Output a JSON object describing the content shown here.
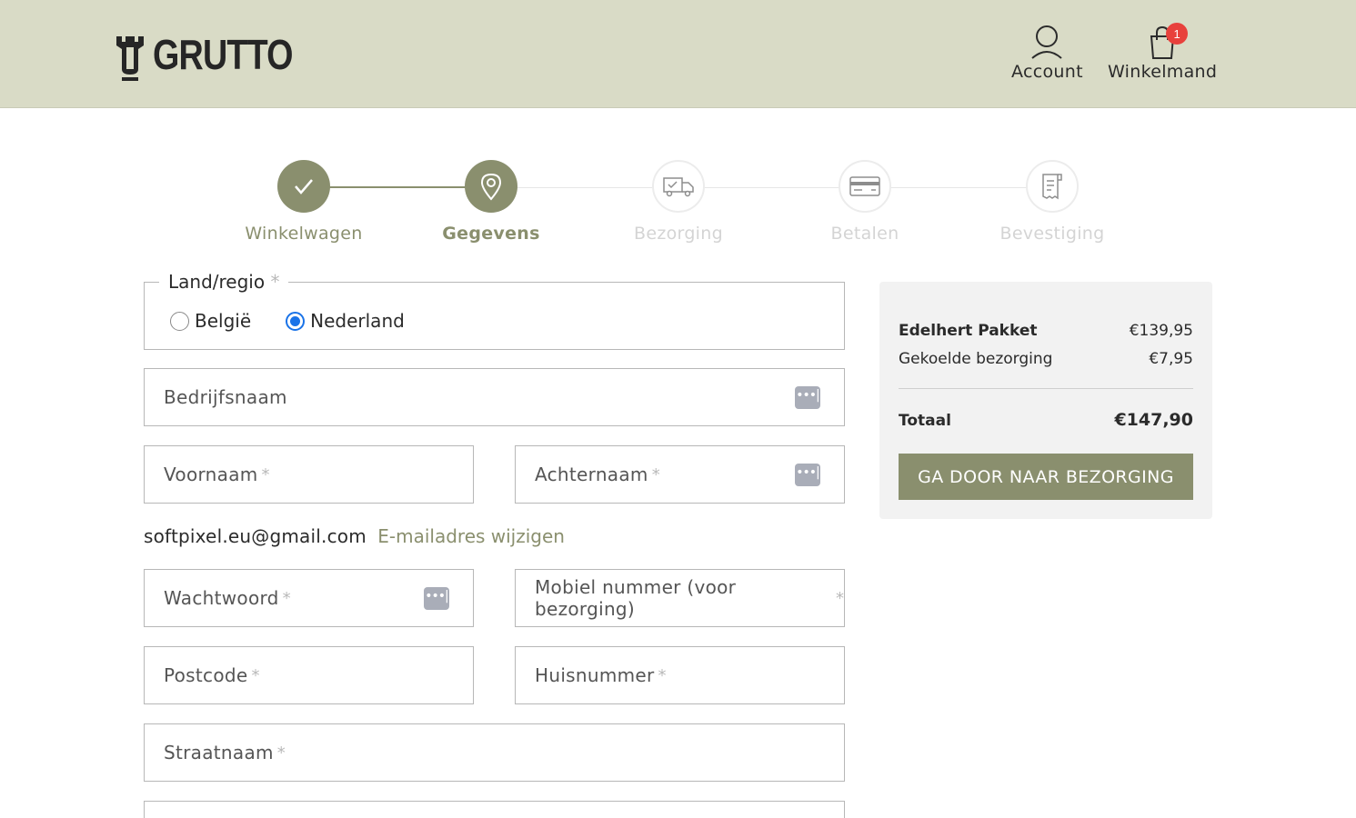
{
  "header": {
    "logo_text": "GRUTTO",
    "account_label": "Account",
    "cart_label": "Winkelmand",
    "cart_count": "1"
  },
  "steps": [
    {
      "label": "Winkelwagen",
      "state": "done",
      "icon": "check-icon"
    },
    {
      "label": "Gegevens",
      "state": "current",
      "icon": "location-pin-icon"
    },
    {
      "label": "Bezorging",
      "state": "upcoming",
      "icon": "delivery-truck-icon"
    },
    {
      "label": "Betalen",
      "state": "upcoming",
      "icon": "credit-card-icon"
    },
    {
      "label": "Bevestiging",
      "state": "upcoming",
      "icon": "receipt-icon"
    }
  ],
  "form": {
    "country": {
      "legend": "Land/regio",
      "required_mark": "*",
      "options": [
        {
          "label": "België",
          "checked": false
        },
        {
          "label": "Nederland",
          "checked": true
        }
      ]
    },
    "company_placeholder": "Bedrijfsnaam",
    "firstname_placeholder": "Voornaam",
    "lastname_placeholder": "Achternaam",
    "email": "softpixel.eu@gmail.com",
    "change_email_link": "E-mailadres wijzigen",
    "password_placeholder": "Wachtwoord",
    "mobile_placeholder": "Mobiel nummer (voor bezorging)",
    "postcode_placeholder": "Postcode",
    "housenumber_placeholder": "Huisnummer",
    "street_placeholder": "Straatnaam",
    "required_mark": "*"
  },
  "summary": {
    "items": [
      {
        "name": "Edelhert Pakket",
        "price": "€139,95"
      },
      {
        "name": "Gekoelde bezorging",
        "price": "€7,95"
      }
    ],
    "total_label": "Totaal",
    "total_value": "€147,90",
    "cta_label": "GA DOOR NAAR BEZORGING"
  },
  "colors": {
    "header_bg": "#d9dbc6",
    "accent": "#8a8f6e",
    "badge": "#e8413c",
    "inactive_text": "#d4d4d4"
  }
}
